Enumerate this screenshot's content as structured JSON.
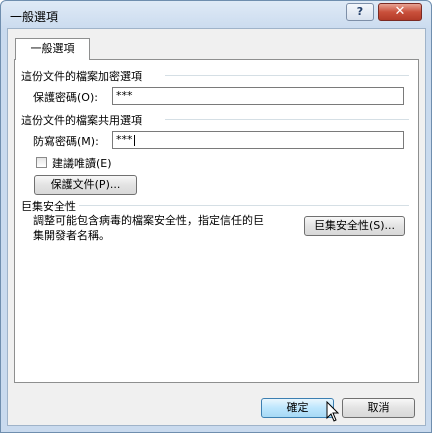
{
  "window": {
    "title": "一般選項"
  },
  "titlebar": {
    "help_glyph": "?",
    "close_glyph": "✕"
  },
  "tabs": [
    {
      "label": "一般選項"
    }
  ],
  "encryption": {
    "heading": "這份文件的檔案加密選項",
    "password_label": "保護密碼(O):",
    "password_value": "***"
  },
  "sharing": {
    "heading": "這份文件的檔案共用選項",
    "password_label": "防寫密碼(M):",
    "password_value": "***",
    "readonly_label": "建議唯讀(E)",
    "readonly_checked": false,
    "protect_button": "保護文件(P)..."
  },
  "macro": {
    "heading": "巨集安全性",
    "description_line1": "調整可能包含病毒的檔案安全性，指定信任的巨",
    "description_line2": "集開發者名稱。",
    "button": "巨集安全性(S)..."
  },
  "footer": {
    "ok_label": "確定",
    "cancel_label": "取消"
  }
}
